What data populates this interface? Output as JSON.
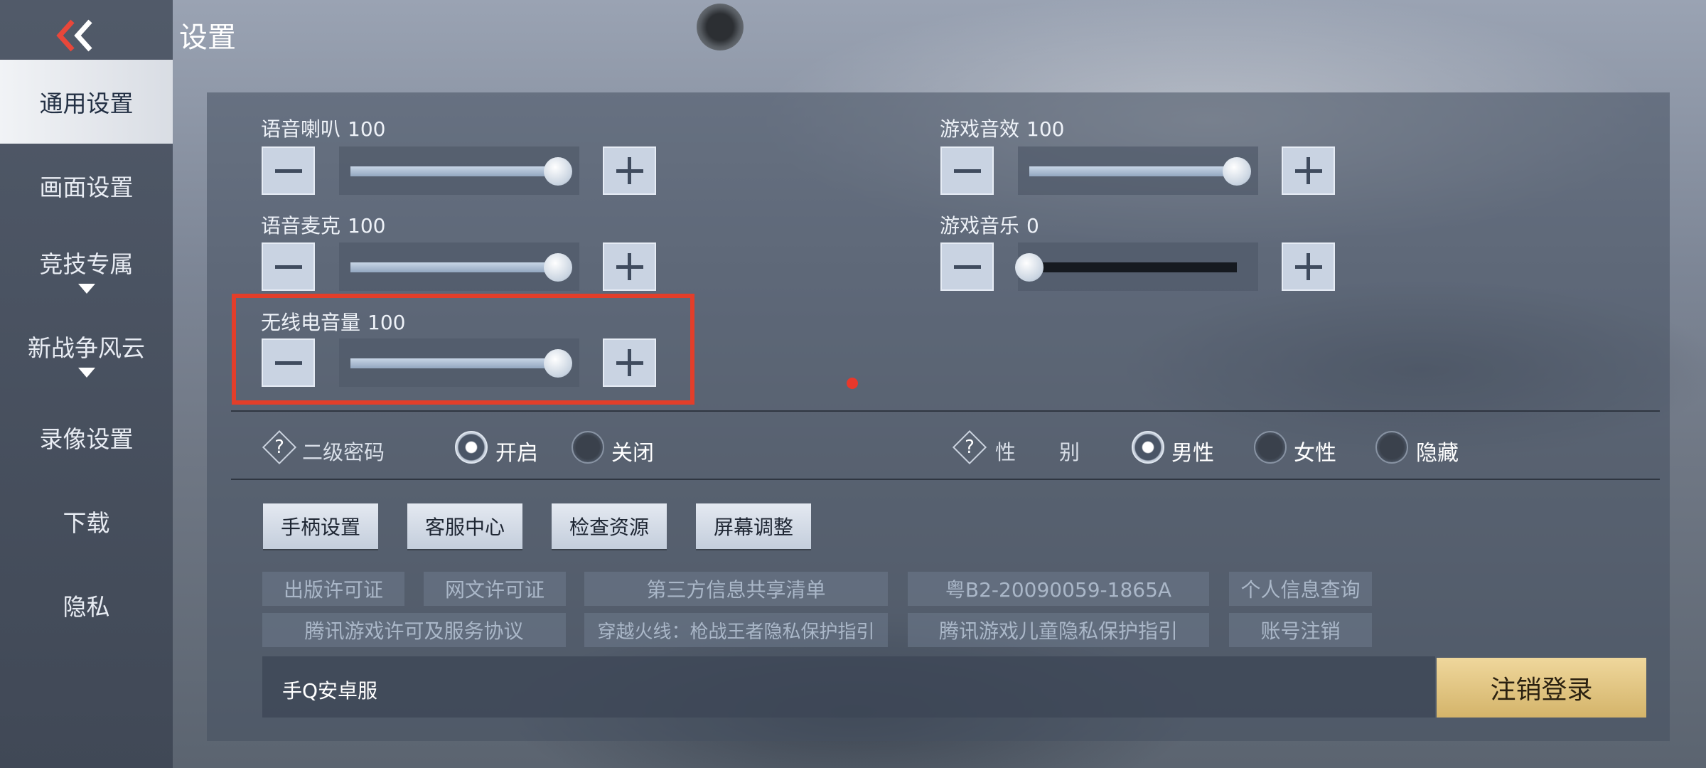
{
  "title": "设置",
  "sidebar": {
    "items": [
      {
        "label": "通用设置",
        "active": true,
        "expandable": false
      },
      {
        "label": "画面设置",
        "active": false,
        "expandable": false
      },
      {
        "label": "竞技专属",
        "active": false,
        "expandable": true
      },
      {
        "label": "新战争风云",
        "active": false,
        "expandable": true
      },
      {
        "label": "录像设置",
        "active": false,
        "expandable": false
      },
      {
        "label": "下载",
        "active": false,
        "expandable": false
      },
      {
        "label": "隐私",
        "active": false,
        "expandable": false
      }
    ]
  },
  "audio": {
    "voice_speaker": {
      "label": "语音喇叭",
      "value": "100",
      "level": 100
    },
    "voice_mic": {
      "label": "语音麦克",
      "value": "100",
      "level": 100
    },
    "radio_volume": {
      "label": "无线电音量",
      "value": "100",
      "level": 100
    },
    "game_sfx": {
      "label": "游戏音效",
      "value": "100",
      "level": 100
    },
    "game_music": {
      "label": "游戏音乐",
      "value": "0",
      "level": 0
    }
  },
  "secondary_password": {
    "label": "二级密码",
    "options": [
      "开启",
      "关闭"
    ],
    "selected": "开启"
  },
  "gender": {
    "label_1": "性",
    "label_2": "别",
    "options": [
      "男性",
      "女性",
      "隐藏"
    ],
    "selected": "男性"
  },
  "actions": [
    "手柄设置",
    "客服中心",
    "检查资源",
    "屏幕调整"
  ],
  "links": {
    "row1": [
      "出版许可证",
      "网文许可证",
      "第三方信息共享清单",
      "粤B2-20090059-1865A",
      "个人信息查询"
    ],
    "row2": [
      "腾讯游戏许可及服务协议",
      "穿越火线：枪战王者隐私保护指引",
      "腾讯游戏儿童隐私保护指引",
      "账号注销"
    ]
  },
  "server": "手Q安卓服",
  "logout_label": "注销登录",
  "colors": {
    "highlight_border": "#e33e2a",
    "logout_gold": "#e2c480",
    "active_tab": "#eef0f4"
  },
  "icons": {
    "back": "double-chevron-left-icon",
    "help": "question-diamond-icon",
    "dropdown": "triangle-down-icon"
  }
}
